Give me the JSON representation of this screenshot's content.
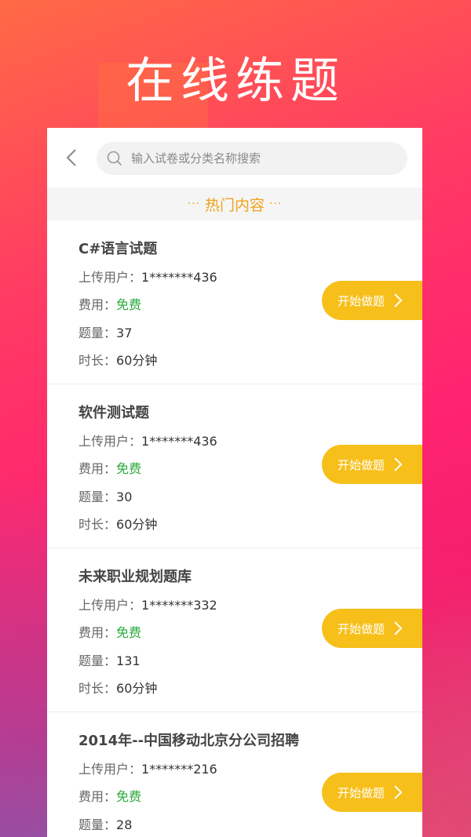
{
  "hero": {
    "title": "在线练题"
  },
  "search": {
    "placeholder": "输入试卷或分类名称搜索"
  },
  "section": {
    "title": "热门内容",
    "dots_left": "···",
    "dots_right": "···"
  },
  "labels": {
    "uploader": "上传用户：",
    "fee": "费用：",
    "count": "题量：",
    "duration": "时长："
  },
  "start_label": "开始做题",
  "items": [
    {
      "title": "C#语言试题",
      "uploader": "1*******436",
      "fee": "免费",
      "count": "37",
      "duration": "60分钟"
    },
    {
      "title": "软件测试题",
      "uploader": "1*******436",
      "fee": "免费",
      "count": "30",
      "duration": "60分钟"
    },
    {
      "title": "未来职业规划题库",
      "uploader": "1*******332",
      "fee": "免费",
      "count": "131",
      "duration": "60分钟"
    },
    {
      "title": "2014年--中国移动北京分公司招聘",
      "uploader": "1*******216",
      "fee": "免费",
      "count": "28",
      "duration": ""
    }
  ],
  "colors": {
    "accent": "#f7bf1a",
    "section_text": "#f0a21a",
    "free_text": "#2aa93c"
  }
}
